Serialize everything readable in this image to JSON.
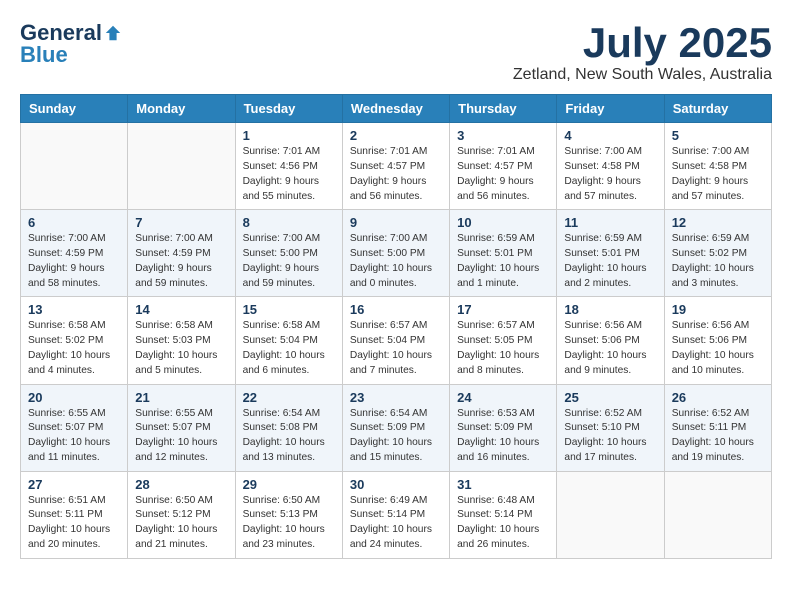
{
  "header": {
    "logo_general": "General",
    "logo_blue": "Blue",
    "month": "July 2025",
    "location": "Zetland, New South Wales, Australia"
  },
  "days_of_week": [
    "Sunday",
    "Monday",
    "Tuesday",
    "Wednesday",
    "Thursday",
    "Friday",
    "Saturday"
  ],
  "weeks": [
    [
      {
        "day": "",
        "info": ""
      },
      {
        "day": "",
        "info": ""
      },
      {
        "day": "1",
        "info": "Sunrise: 7:01 AM\nSunset: 4:56 PM\nDaylight: 9 hours and 55 minutes."
      },
      {
        "day": "2",
        "info": "Sunrise: 7:01 AM\nSunset: 4:57 PM\nDaylight: 9 hours and 56 minutes."
      },
      {
        "day": "3",
        "info": "Sunrise: 7:01 AM\nSunset: 4:57 PM\nDaylight: 9 hours and 56 minutes."
      },
      {
        "day": "4",
        "info": "Sunrise: 7:00 AM\nSunset: 4:58 PM\nDaylight: 9 hours and 57 minutes."
      },
      {
        "day": "5",
        "info": "Sunrise: 7:00 AM\nSunset: 4:58 PM\nDaylight: 9 hours and 57 minutes."
      }
    ],
    [
      {
        "day": "6",
        "info": "Sunrise: 7:00 AM\nSunset: 4:59 PM\nDaylight: 9 hours and 58 minutes."
      },
      {
        "day": "7",
        "info": "Sunrise: 7:00 AM\nSunset: 4:59 PM\nDaylight: 9 hours and 59 minutes."
      },
      {
        "day": "8",
        "info": "Sunrise: 7:00 AM\nSunset: 5:00 PM\nDaylight: 9 hours and 59 minutes."
      },
      {
        "day": "9",
        "info": "Sunrise: 7:00 AM\nSunset: 5:00 PM\nDaylight: 10 hours and 0 minutes."
      },
      {
        "day": "10",
        "info": "Sunrise: 6:59 AM\nSunset: 5:01 PM\nDaylight: 10 hours and 1 minute."
      },
      {
        "day": "11",
        "info": "Sunrise: 6:59 AM\nSunset: 5:01 PM\nDaylight: 10 hours and 2 minutes."
      },
      {
        "day": "12",
        "info": "Sunrise: 6:59 AM\nSunset: 5:02 PM\nDaylight: 10 hours and 3 minutes."
      }
    ],
    [
      {
        "day": "13",
        "info": "Sunrise: 6:58 AM\nSunset: 5:02 PM\nDaylight: 10 hours and 4 minutes."
      },
      {
        "day": "14",
        "info": "Sunrise: 6:58 AM\nSunset: 5:03 PM\nDaylight: 10 hours and 5 minutes."
      },
      {
        "day": "15",
        "info": "Sunrise: 6:58 AM\nSunset: 5:04 PM\nDaylight: 10 hours and 6 minutes."
      },
      {
        "day": "16",
        "info": "Sunrise: 6:57 AM\nSunset: 5:04 PM\nDaylight: 10 hours and 7 minutes."
      },
      {
        "day": "17",
        "info": "Sunrise: 6:57 AM\nSunset: 5:05 PM\nDaylight: 10 hours and 8 minutes."
      },
      {
        "day": "18",
        "info": "Sunrise: 6:56 AM\nSunset: 5:06 PM\nDaylight: 10 hours and 9 minutes."
      },
      {
        "day": "19",
        "info": "Sunrise: 6:56 AM\nSunset: 5:06 PM\nDaylight: 10 hours and 10 minutes."
      }
    ],
    [
      {
        "day": "20",
        "info": "Sunrise: 6:55 AM\nSunset: 5:07 PM\nDaylight: 10 hours and 11 minutes."
      },
      {
        "day": "21",
        "info": "Sunrise: 6:55 AM\nSunset: 5:07 PM\nDaylight: 10 hours and 12 minutes."
      },
      {
        "day": "22",
        "info": "Sunrise: 6:54 AM\nSunset: 5:08 PM\nDaylight: 10 hours and 13 minutes."
      },
      {
        "day": "23",
        "info": "Sunrise: 6:54 AM\nSunset: 5:09 PM\nDaylight: 10 hours and 15 minutes."
      },
      {
        "day": "24",
        "info": "Sunrise: 6:53 AM\nSunset: 5:09 PM\nDaylight: 10 hours and 16 minutes."
      },
      {
        "day": "25",
        "info": "Sunrise: 6:52 AM\nSunset: 5:10 PM\nDaylight: 10 hours and 17 minutes."
      },
      {
        "day": "26",
        "info": "Sunrise: 6:52 AM\nSunset: 5:11 PM\nDaylight: 10 hours and 19 minutes."
      }
    ],
    [
      {
        "day": "27",
        "info": "Sunrise: 6:51 AM\nSunset: 5:11 PM\nDaylight: 10 hours and 20 minutes."
      },
      {
        "day": "28",
        "info": "Sunrise: 6:50 AM\nSunset: 5:12 PM\nDaylight: 10 hours and 21 minutes."
      },
      {
        "day": "29",
        "info": "Sunrise: 6:50 AM\nSunset: 5:13 PM\nDaylight: 10 hours and 23 minutes."
      },
      {
        "day": "30",
        "info": "Sunrise: 6:49 AM\nSunset: 5:14 PM\nDaylight: 10 hours and 24 minutes."
      },
      {
        "day": "31",
        "info": "Sunrise: 6:48 AM\nSunset: 5:14 PM\nDaylight: 10 hours and 26 minutes."
      },
      {
        "day": "",
        "info": ""
      },
      {
        "day": "",
        "info": ""
      }
    ]
  ]
}
